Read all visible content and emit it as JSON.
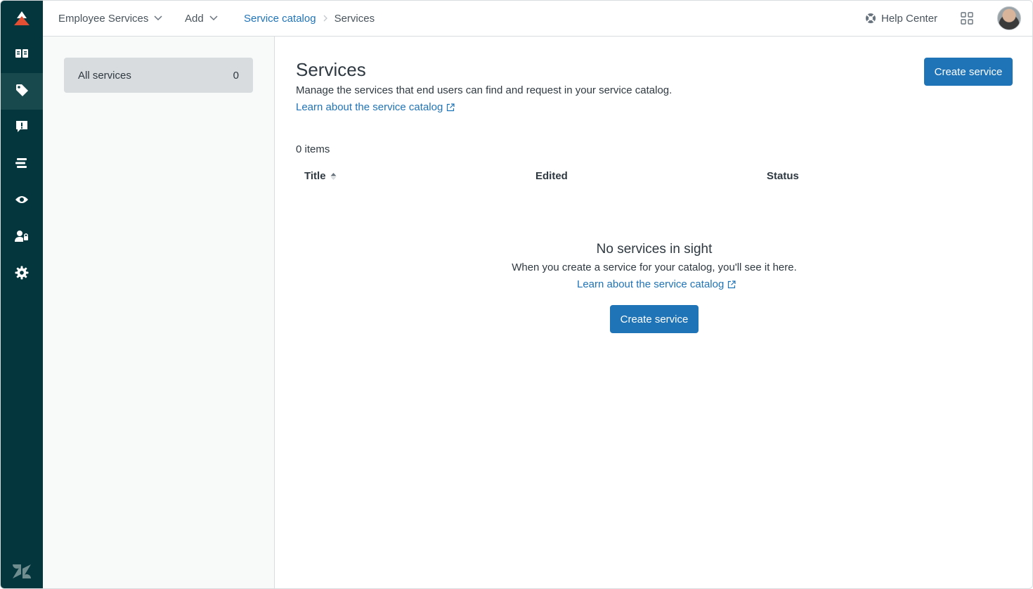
{
  "header": {
    "product_menu": "Employee Services",
    "add_menu": "Add",
    "breadcrumb": {
      "parent": "Service catalog",
      "current": "Services"
    },
    "help_center": "Help Center"
  },
  "rail": {
    "items": [
      {
        "icon": "book-icon"
      },
      {
        "icon": "tag-icon",
        "active": true
      },
      {
        "icon": "alert-message-icon"
      },
      {
        "icon": "list-icon"
      },
      {
        "icon": "eye-icon"
      },
      {
        "icon": "user-lock-icon"
      },
      {
        "icon": "gear-icon"
      }
    ]
  },
  "sidebar": {
    "filter": {
      "label": "All services",
      "count": "0"
    }
  },
  "main": {
    "title": "Services",
    "description": "Manage the services that end users can find and request in your service catalog.",
    "learn_link": "Learn about the service catalog",
    "create_button": "Create service",
    "item_count": "0 items",
    "columns": [
      "Title",
      "Edited",
      "Status"
    ],
    "empty": {
      "title": "No services in sight",
      "description": "When you create a service for your catalog, you'll see it here.",
      "learn_link": "Learn about the service catalog",
      "button": "Create service"
    }
  },
  "colors": {
    "rail": "#03363d",
    "rail_active": "#17494d",
    "accent": "#1f73b7",
    "brand_red": "#e34f32"
  }
}
